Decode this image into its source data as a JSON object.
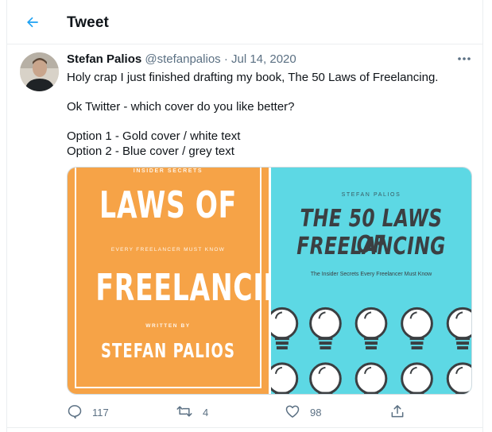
{
  "header": {
    "title": "Tweet"
  },
  "tweet": {
    "author_name": "Stefan Palios",
    "author_handle": "@stefanpalios",
    "separator": "·",
    "date": "Jul 14, 2020",
    "lines": [
      "Holy crap I just finished drafting my book, The 50 Laws of Freelancing.",
      "Ok Twitter - which cover do you like better?",
      "Option 1 - Gold cover / white text",
      "Option 2 - Blue cover / grey text"
    ]
  },
  "cover_a": {
    "top_text": "INSIDER SECRETS",
    "title_line1": "LAWS OF",
    "subtitle": "EVERY FREELANCER MUST KNOW",
    "title_line2": "FREELANCING",
    "written_by": "WRITTEN BY",
    "author": "STEFAN PALIOS",
    "color": "#f6a347"
  },
  "cover_b": {
    "author": "STEFAN PALIOS",
    "title_line1": "THE 50 LAWS OF",
    "title_line2": "FREELANCING",
    "subtitle": "The Insider Secrets Every Freelancer Must Know",
    "color": "#5dd8e4"
  },
  "actions": {
    "replies": "117",
    "retweets": "4",
    "likes": "98"
  },
  "colors": {
    "accent": "#1da1f2",
    "muted": "#5b7083"
  },
  "icons": [
    "back-arrow-icon",
    "more-icon",
    "reply-icon",
    "retweet-icon",
    "like-icon",
    "share-icon",
    "lightbulb-icon"
  ]
}
